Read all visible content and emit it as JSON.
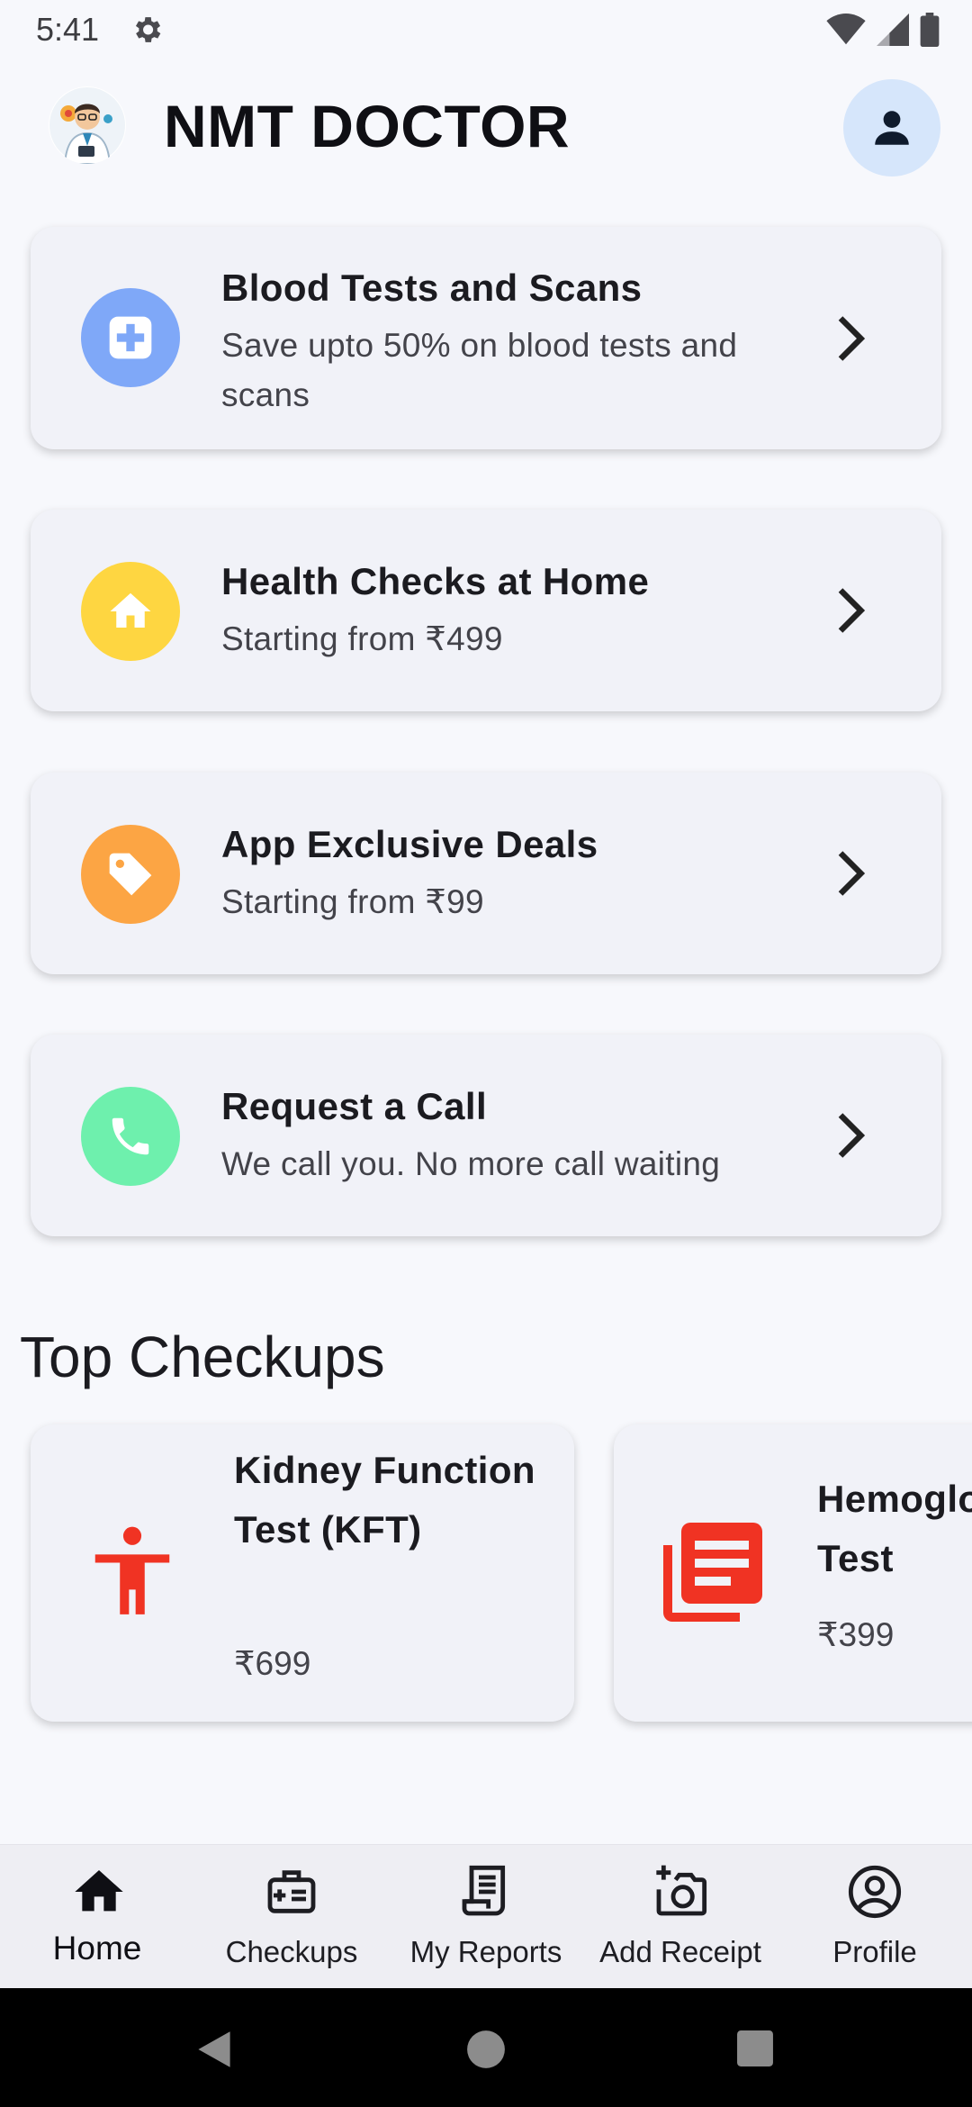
{
  "status_bar": {
    "time": "5:41"
  },
  "header": {
    "title": "NMT DOCTOR"
  },
  "services": [
    {
      "title": "Blood Tests and Scans",
      "subtitle": "Save upto 50% on blood tests and scans",
      "icon": "medical-plus-icon",
      "color": "#7fa8f8"
    },
    {
      "title": "Health Checks at Home",
      "subtitle": "Starting from ₹499",
      "icon": "home-icon",
      "color": "#fed641"
    },
    {
      "title": "App Exclusive Deals",
      "subtitle": "Starting from ₹99",
      "icon": "tag-icon",
      "color": "#fca544"
    },
    {
      "title": "Request a Call",
      "subtitle": "We call you. No more call waiting",
      "icon": "phone-icon",
      "color": "#6ef0ad"
    }
  ],
  "top_checkups": {
    "title": "Top Checkups",
    "items": [
      {
        "name": "Kidney Function Test (KFT)",
        "price": "₹699",
        "icon": "accessibility-icon"
      },
      {
        "name": "Hemoglobin Test",
        "price": "₹399",
        "icon": "library-books-icon"
      }
    ]
  },
  "bottom_nav": [
    {
      "label": "Home",
      "icon": "home-icon",
      "active": true
    },
    {
      "label": "Checkups",
      "icon": "medical-bag-icon",
      "active": false
    },
    {
      "label": "My Reports",
      "icon": "receipt-icon",
      "active": false
    },
    {
      "label": "Add Receipt",
      "icon": "camera-add-icon",
      "active": false
    },
    {
      "label": "Profile",
      "icon": "account-circle-icon",
      "active": false
    }
  ],
  "colors": {
    "accent_icon_red": "#f03323",
    "avatar_bg": "#d6e6fb"
  }
}
